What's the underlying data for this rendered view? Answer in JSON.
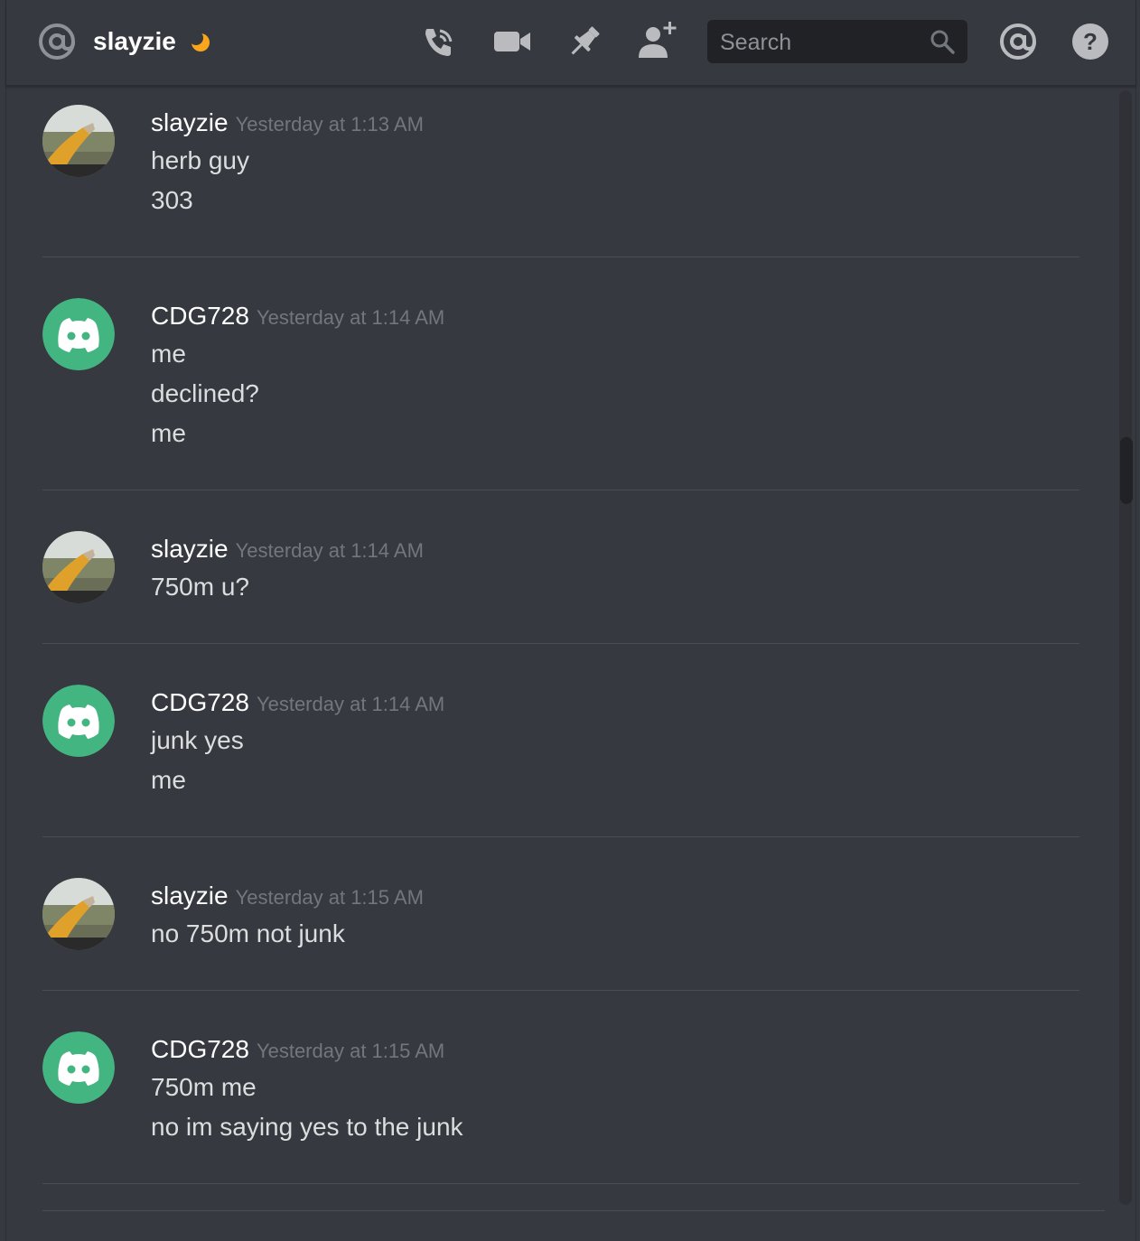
{
  "header": {
    "channel_name": "slayzie",
    "search_placeholder": "Search"
  },
  "icons": {
    "at": "at-icon",
    "status": "moon-icon",
    "call": "phone-call-icon",
    "video": "video-camera-icon",
    "pin": "pin-icon",
    "add_user": "add-user-icon",
    "search": "search-icon",
    "mentions": "at-mentions-icon",
    "help": "help-icon"
  },
  "colors": {
    "background": "#36393f",
    "status_idle": "#faa61a",
    "discord_avatar": "#43b581"
  },
  "messages": [
    {
      "author": "slayzie",
      "timestamp": "Yesterday at 1:13 AM",
      "lines": [
        "herb guy",
        "303"
      ]
    },
    {
      "author": "CDG728",
      "timestamp": "Yesterday at 1:14 AM",
      "lines": [
        "me",
        "declined?",
        "me"
      ]
    },
    {
      "author": "slayzie",
      "timestamp": "Yesterday at 1:14 AM",
      "lines": [
        "750m u?"
      ]
    },
    {
      "author": "CDG728",
      "timestamp": "Yesterday at 1:14 AM",
      "lines": [
        "junk yes",
        "me"
      ]
    },
    {
      "author": "slayzie",
      "timestamp": "Yesterday at 1:15 AM",
      "lines": [
        "no 750m not junk"
      ]
    },
    {
      "author": "CDG728",
      "timestamp": "Yesterday at 1:15 AM",
      "lines": [
        "750m me",
        "no im saying yes to the junk"
      ]
    }
  ]
}
